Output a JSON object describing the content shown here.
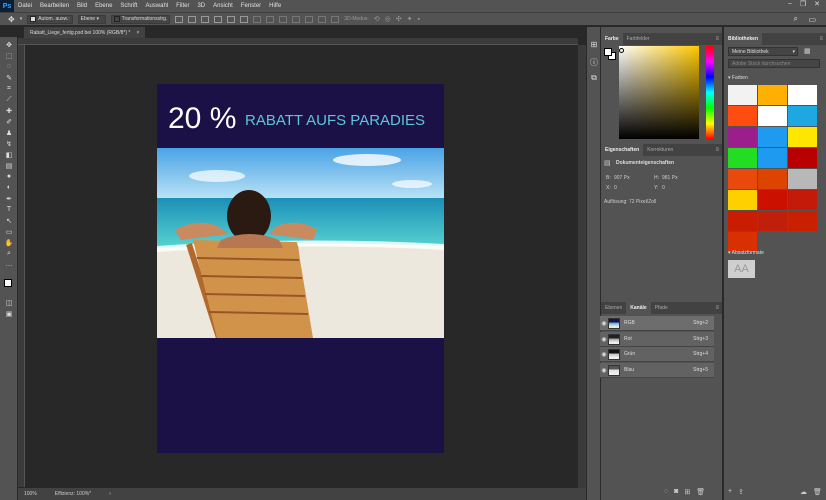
{
  "menubar": {
    "logo": "Ps",
    "items": [
      "Datei",
      "Bearbeiten",
      "Bild",
      "Ebene",
      "Schrift",
      "Auswahl",
      "Filter",
      "3D",
      "Ansicht",
      "Fenster",
      "Hilfe"
    ],
    "window_controls": [
      "–",
      "❐",
      "✕"
    ]
  },
  "options": {
    "auto_select_label": "Autom. ausw.:",
    "auto_select_value": "Ebene",
    "transform_label": "Transformationsstrg.",
    "mode_3d_label": "3D-Modus:"
  },
  "document_tab": {
    "title": "Rabatt_Liege_fertig.psd bei 100% (RGB/8*) *",
    "close": "×"
  },
  "artboard": {
    "headline_big": "20 %",
    "headline_small": "RABATT AUFS PARADIES",
    "bg_color": "#1c1146",
    "accent_color": "#5cc4dc"
  },
  "statusbar": {
    "zoom": "100%",
    "info": "Effizienz: 100%*",
    "arrow": "›"
  },
  "color_panel": {
    "tabs": [
      "Farbe",
      "Farbfelder"
    ]
  },
  "properties_panel": {
    "tabs": [
      "Eigenschaften",
      "Korrekturen"
    ],
    "title": "Dokumenteigenschaften",
    "w_label": "B:",
    "w_value": "907 Px",
    "h_label": "H:",
    "h_value": "981 Px",
    "x_label": "X:",
    "x_value": "0",
    "y_label": "Y:",
    "y_value": "0",
    "resolution": "Auflösung: 72 Pixel/Zoll"
  },
  "layers_panel": {
    "tabs": [
      "Ebenen",
      "Kanäle",
      "Pfade"
    ],
    "rows": [
      {
        "name": "RGB",
        "shortcut": "Strg+2"
      },
      {
        "name": "Rot",
        "shortcut": "Strg+3"
      },
      {
        "name": "Grün",
        "shortcut": "Strg+4"
      },
      {
        "name": "Blau",
        "shortcut": "Strg+5"
      }
    ]
  },
  "library_panel": {
    "tabs": [
      "Bibliotheken"
    ],
    "library": "Meine Bibliothek",
    "search_placeholder": "Adobe Stock durchsuchen",
    "colors_label": "Farben",
    "text_styles_label": "Absatzformate",
    "text_sample": "AA",
    "swatches": [
      "#f2f2f2",
      "#ffb000",
      "#ffffff",
      "#ff4d12",
      "#ffffff",
      "#1ea7e1",
      "#9b1e8c",
      "#1e9bf0",
      "#ffe600",
      "#22dd22",
      "#1e9bf0",
      "#b80000",
      "#e84a0c",
      "#dd4400",
      "#b8b8b8",
      "#ffd000",
      "#cc1000",
      "#c41a0a",
      "#c91c00",
      "#c01f0a",
      "#c82000",
      "#d83000"
    ]
  }
}
